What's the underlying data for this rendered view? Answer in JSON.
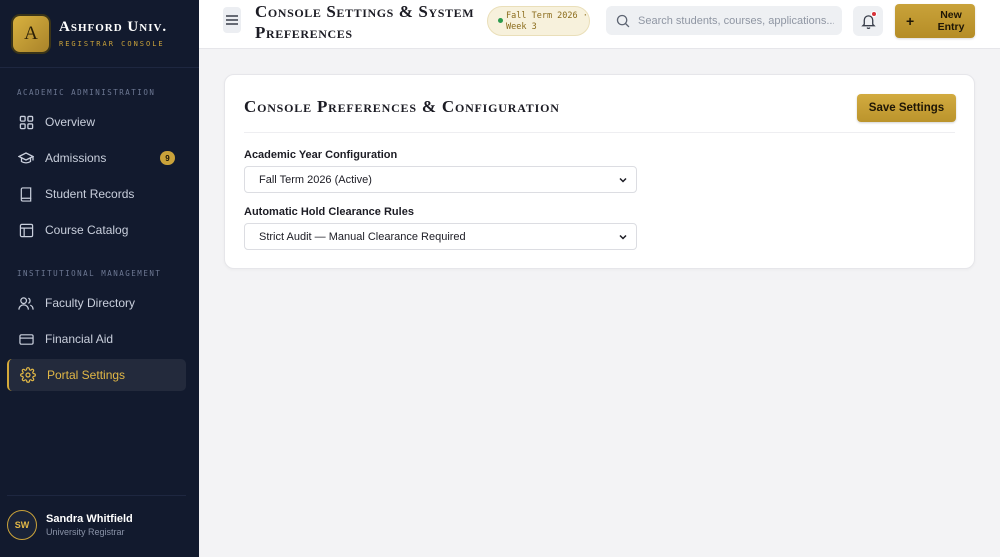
{
  "brand": {
    "logo_letter": "A",
    "name": "Ashford Univ.",
    "subtitle": "REGISTRAR CONSOLE"
  },
  "sidebar": {
    "sections": [
      {
        "label": "ACADEMIC ADMINISTRATION"
      },
      {
        "label": "INSTITUTIONAL MANAGEMENT"
      }
    ],
    "items": [
      {
        "label": "Overview",
        "icon": "grid-icon"
      },
      {
        "label": "Admissions",
        "icon": "graduation-cap-icon",
        "badge": "9"
      },
      {
        "label": "Student Records",
        "icon": "book-icon"
      },
      {
        "label": "Course Catalog",
        "icon": "layout-icon"
      },
      {
        "label": "Faculty Directory",
        "icon": "users-icon"
      },
      {
        "label": "Financial Aid",
        "icon": "credit-card-icon"
      },
      {
        "label": "Portal Settings",
        "icon": "gear-icon",
        "active": true
      }
    ]
  },
  "user": {
    "initials": "SW",
    "name": "Sandra Whitfield",
    "role": "University Registrar"
  },
  "header": {
    "title": "Console Settings & System Preferences",
    "term": "Fall Term 2026 · Week 3",
    "search_placeholder": "Search students, courses, applications...",
    "new_entry_label": "New Entry",
    "new_entry_icon": "+"
  },
  "settings": {
    "title": "Console Preferences & Configuration",
    "save_label": "Save Settings",
    "fields": [
      {
        "label": "Academic Year Configuration",
        "value": "Fall Term 2026 (Active)"
      },
      {
        "label": "Automatic Hold Clearance Rules",
        "value": "Strict Audit — Manual Clearance Required"
      }
    ]
  },
  "colors": {
    "sidebar_bg": "#121a2e",
    "accent_gold": "#c9a23a",
    "page_bg": "#f3f3f5",
    "notification": "#d8323a"
  }
}
